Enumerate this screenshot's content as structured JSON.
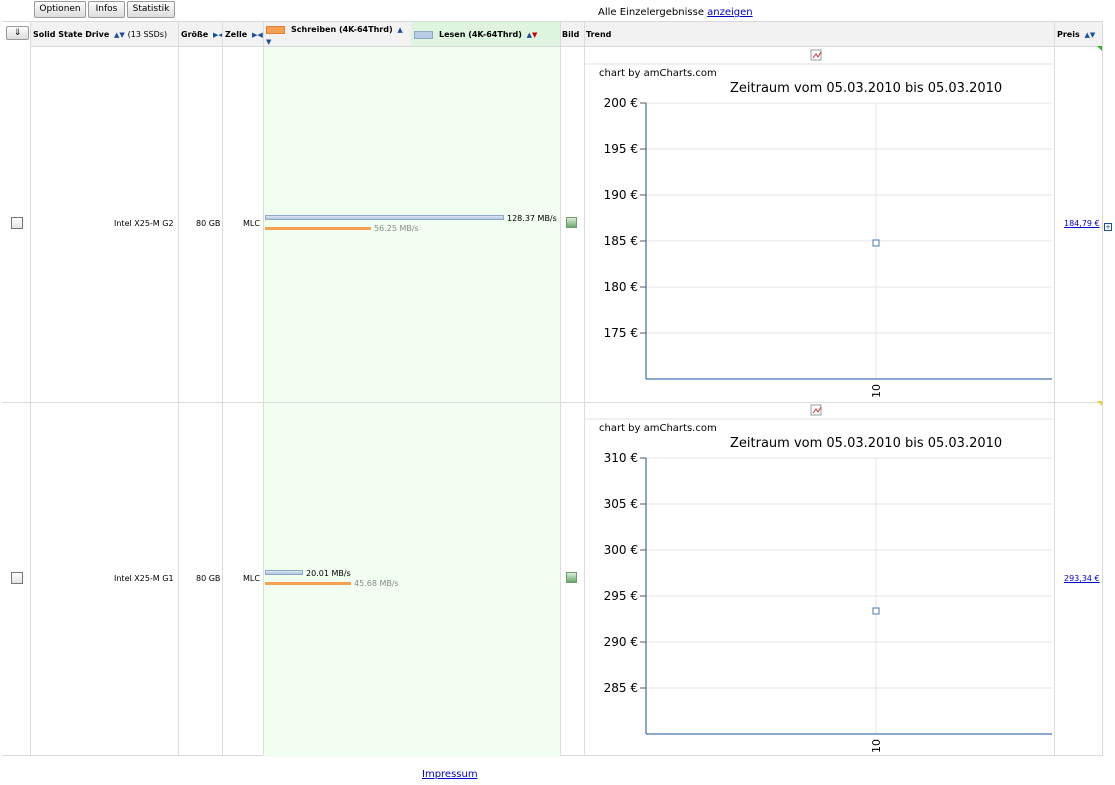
{
  "toolbar": {
    "options": "Optionen",
    "infos": "Infos",
    "stats": "Statistik"
  },
  "top": {
    "text": "Alle Einzelergebnisse",
    "link": "anzeigen"
  },
  "header": {
    "sort_button": "⇓",
    "col_name": "Solid State Drive",
    "col_count": "(13 SSDs)",
    "col_size": "Größe",
    "col_cell": "Zelle",
    "col_write": "Schreiben (4K-64Thrd)",
    "col_read": "Lesen (4K-64Thrd)",
    "col_image": "Bild",
    "col_trend": "Trend",
    "col_price": "Preis"
  },
  "colors": {
    "write": "#f5a050",
    "read": "#b8cde6",
    "highlight": "#f0fff0",
    "link": "#0000cc"
  },
  "rows": [
    {
      "name": "Intel X25-M G2",
      "size": "80 GB",
      "cell": "MLC",
      "read_label": "128.37 MB/s",
      "write_label": "56.25 MB/s",
      "read_value": 128.37,
      "write_value": 56.25,
      "price": "184,79 €",
      "chart": {
        "credit": "chart by amCharts.com",
        "title": "Zeitraum vom 05.03.2010 bis 05.03.2010",
        "y_ticks": [
          "200 €",
          "195 €",
          "190 €",
          "185 €",
          "180 €",
          "175 €"
        ],
        "x_label": "10"
      }
    },
    {
      "name": "Intel X25-M G1",
      "size": "80 GB",
      "cell": "MLC",
      "read_label": "20.01 MB/s",
      "write_label": "45.68 MB/s",
      "read_value": 20.01,
      "write_value": 45.68,
      "price": "293,34 €",
      "chart": {
        "credit": "chart by amCharts.com",
        "title": "Zeitraum vom 05.03.2010 bis 05.03.2010",
        "y_ticks": [
          "310 €",
          "305 €",
          "300 €",
          "295 €",
          "290 €",
          "285 €"
        ],
        "x_label": "10"
      }
    }
  ],
  "chart_data": [
    {
      "type": "line",
      "title": "Zeitraum vom 05.03.2010 bis 05.03.2010",
      "x": [
        "10"
      ],
      "values": [
        184.79
      ],
      "ylim": [
        170,
        200
      ]
    },
    {
      "type": "line",
      "title": "Zeitraum vom 05.03.2010 bis 05.03.2010",
      "x": [
        "10"
      ],
      "values": [
        293.34
      ],
      "ylim": [
        280,
        310
      ]
    }
  ],
  "footer": {
    "link": "Impressum"
  }
}
